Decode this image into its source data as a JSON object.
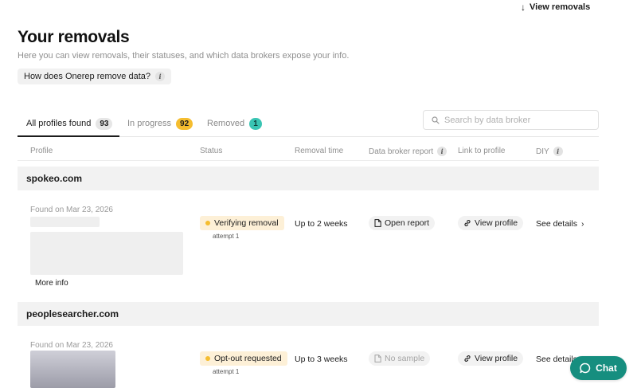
{
  "header": {
    "view_removals_label": "View removals",
    "title": "Your removals",
    "subtitle": "Here you can view removals, their statuses, and which data brokers expose your info.",
    "how_label": "How does Onerep remove data?"
  },
  "tabs": [
    {
      "label": "All profiles found",
      "count": "93"
    },
    {
      "label": "In progress",
      "count": "92"
    },
    {
      "label": "Removed",
      "count": "1"
    }
  ],
  "search": {
    "placeholder": "Search by data broker"
  },
  "columns": {
    "profile": "Profile",
    "status": "Status",
    "removal_time": "Removal time",
    "report": "Data broker report",
    "link": "Link to profile",
    "diy": "DIY"
  },
  "rows": [
    {
      "broker": "spokeo.com",
      "found": "Found on Mar 23, 2026",
      "status": "Verifying removal",
      "attempt": "attempt 1",
      "removal_time": "Up to 2 weeks",
      "report": "Open report",
      "link": "View profile",
      "diy": "See details",
      "more_info": "More info"
    },
    {
      "broker": "peoplesearcher.com",
      "found": "Found on Mar 23, 2026",
      "status": "Opt-out requested",
      "attempt": "attempt 1",
      "removal_time": "Up to 3 weeks",
      "report": "No sample",
      "link": "View profile",
      "diy": "See details"
    }
  ],
  "chat": {
    "label": "Chat"
  },
  "colors": {
    "accent": "#168e7f",
    "status_yellow": "#f5bd2f",
    "removed_teal": "#39c4b3"
  }
}
